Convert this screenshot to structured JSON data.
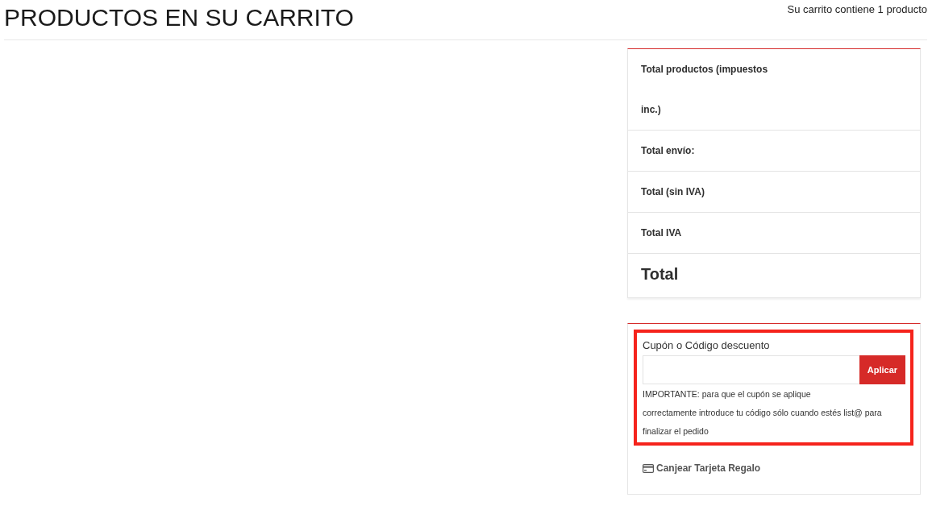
{
  "header": {
    "title": "PRODUCTOS EN SU CARRITO",
    "cart_count": "Su carrito contiene 1 producto"
  },
  "summary": {
    "rows": [
      {
        "kind": "line",
        "label": "Total productos (impuestos inc.)"
      },
      {
        "kind": "line",
        "label": "Total envío:"
      },
      {
        "kind": "line",
        "label": "Total (sin IVA)"
      },
      {
        "kind": "line",
        "label": "Total IVA"
      },
      {
        "kind": "grand",
        "label": "Total"
      }
    ]
  },
  "coupon": {
    "highlighted": true,
    "label": "Cupón o Código descuento",
    "button": "Aplicar",
    "note_lines": [
      "IMPORTANTE: para que el cupón se aplique",
      "correctamente introduce tu código sólo cuando estés list@ para",
      "finalizar el pedido"
    ]
  },
  "gift_card": {
    "label": "Canjear Tarjeta Regalo"
  }
}
